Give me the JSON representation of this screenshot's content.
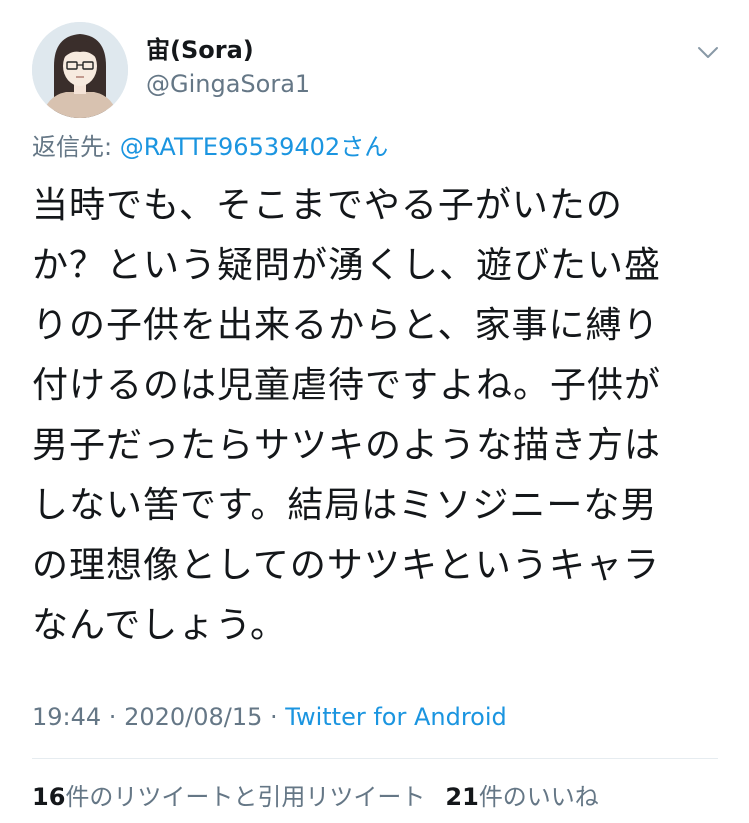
{
  "author": {
    "display_name": "宙(Sora)",
    "handle": "@GingaSora1"
  },
  "icons": {
    "avatar": "woman-with-glasses-avatar",
    "menu": "chevron-down-icon"
  },
  "reply": {
    "prefix": "返信先: ",
    "mention": "@RATTE96539402さん"
  },
  "tweet": {
    "lines": [
      "当時でも、そこまでやる子がいたの",
      "か？という疑問が湧くし、遊びたい盛",
      "りの子供を出来るからと、家事に縛り",
      "付けるのは児童虐待ですよね。子供が",
      "男子だったらサツキのような描き方は",
      "しない筈です。結局はミソジニーな男",
      "の理想像としてのサツキというキャラ",
      "なんでしょう。"
    ]
  },
  "meta": {
    "time": "19:44",
    "separator": " · ",
    "date": "2020/08/15",
    "source": "Twitter for Android"
  },
  "stats": {
    "retweets_count": "16",
    "retweets_label": "件のリツイートと引用リツイート",
    "likes_count": "21",
    "likes_label": "件のいいね"
  },
  "colors": {
    "text": "#14171a",
    "secondary": "#657786",
    "link": "#1b95e0",
    "divider": "#e6ecf0"
  }
}
